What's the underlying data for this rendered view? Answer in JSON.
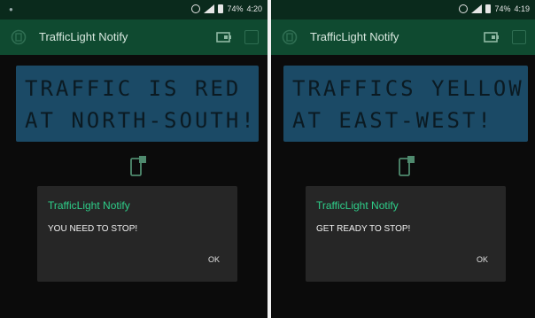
{
  "screens": [
    {
      "status": {
        "left_icon": "notification-dot",
        "battery": "74%",
        "time": "4:20"
      },
      "app_title": "TrafficLight Notify",
      "lcd": {
        "line1": "TRAFFIC IS RED",
        "line2": "AT NORTH-SOUTH!"
      },
      "dialog": {
        "title": "TrafficLight Notify",
        "message": "YOU NEED TO STOP!",
        "ok": "OK"
      }
    },
    {
      "status": {
        "battery": "74%",
        "time": "4:19"
      },
      "app_title": "TrafficLight Notify",
      "lcd": {
        "line1": "TRAFFICS YELLOW",
        "line2": "AT EAST-WEST!"
      },
      "dialog": {
        "title": "TrafficLight Notify",
        "message": "GET READY TO STOP!",
        "ok": "OK"
      }
    }
  ],
  "colors": {
    "appbar": "#0f4a30",
    "lcd": "#1b4a66",
    "accent": "#2ecf8a",
    "dialog": "#262626"
  }
}
